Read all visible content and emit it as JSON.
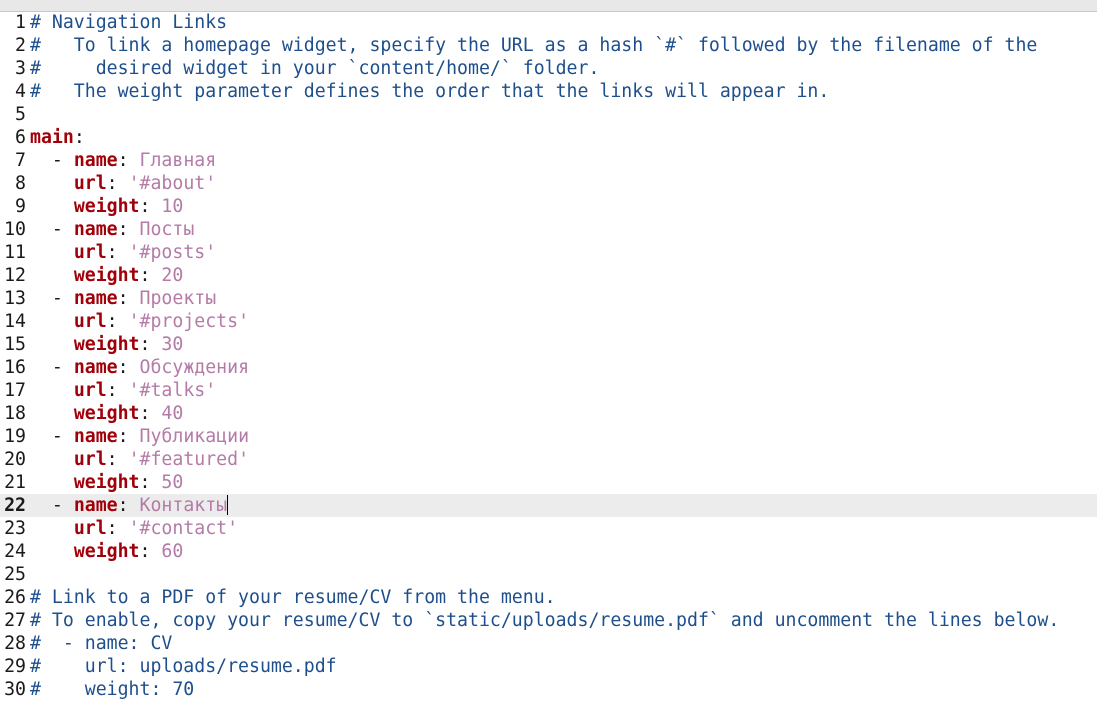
{
  "editor": {
    "current_line": 22,
    "lines": [
      {
        "n": "1",
        "tokens": [
          {
            "t": "# Navigation Links",
            "k": "comment"
          }
        ]
      },
      {
        "n": "2",
        "tokens": [
          {
            "t": "#   To link a homepage widget, specify the URL as a hash `#` followed by the filename of the",
            "k": "comment"
          }
        ]
      },
      {
        "n": "3",
        "tokens": [
          {
            "t": "#     desired widget in your `content/home/` folder.",
            "k": "comment"
          }
        ]
      },
      {
        "n": "4",
        "tokens": [
          {
            "t": "#   The weight parameter defines the order that the links will appear in.",
            "k": "comment"
          }
        ]
      },
      {
        "n": "5",
        "tokens": []
      },
      {
        "n": "6",
        "tokens": [
          {
            "t": "main",
            "k": "key"
          },
          {
            "t": ":",
            "k": "punct"
          }
        ]
      },
      {
        "n": "7",
        "tokens": [
          {
            "t": "  - ",
            "k": "plain"
          },
          {
            "t": "name",
            "k": "key"
          },
          {
            "t": ": ",
            "k": "punct"
          },
          {
            "t": "Главная",
            "k": "str"
          }
        ]
      },
      {
        "n": "8",
        "tokens": [
          {
            "t": "    ",
            "k": "plain"
          },
          {
            "t": "url",
            "k": "key"
          },
          {
            "t": ": ",
            "k": "punct"
          },
          {
            "t": "'#about'",
            "k": "str"
          }
        ]
      },
      {
        "n": "9",
        "tokens": [
          {
            "t": "    ",
            "k": "plain"
          },
          {
            "t": "weight",
            "k": "key"
          },
          {
            "t": ": ",
            "k": "punct"
          },
          {
            "t": "10",
            "k": "num"
          }
        ]
      },
      {
        "n": "10",
        "tokens": [
          {
            "t": "  - ",
            "k": "plain"
          },
          {
            "t": "name",
            "k": "key"
          },
          {
            "t": ": ",
            "k": "punct"
          },
          {
            "t": "Посты",
            "k": "str"
          }
        ]
      },
      {
        "n": "11",
        "tokens": [
          {
            "t": "    ",
            "k": "plain"
          },
          {
            "t": "url",
            "k": "key"
          },
          {
            "t": ": ",
            "k": "punct"
          },
          {
            "t": "'#posts'",
            "k": "str"
          }
        ]
      },
      {
        "n": "12",
        "tokens": [
          {
            "t": "    ",
            "k": "plain"
          },
          {
            "t": "weight",
            "k": "key"
          },
          {
            "t": ": ",
            "k": "punct"
          },
          {
            "t": "20",
            "k": "num"
          }
        ]
      },
      {
        "n": "13",
        "tokens": [
          {
            "t": "  - ",
            "k": "plain"
          },
          {
            "t": "name",
            "k": "key"
          },
          {
            "t": ": ",
            "k": "punct"
          },
          {
            "t": "Проекты",
            "k": "str"
          }
        ]
      },
      {
        "n": "14",
        "tokens": [
          {
            "t": "    ",
            "k": "plain"
          },
          {
            "t": "url",
            "k": "key"
          },
          {
            "t": ": ",
            "k": "punct"
          },
          {
            "t": "'#projects'",
            "k": "str"
          }
        ]
      },
      {
        "n": "15",
        "tokens": [
          {
            "t": "    ",
            "k": "plain"
          },
          {
            "t": "weight",
            "k": "key"
          },
          {
            "t": ": ",
            "k": "punct"
          },
          {
            "t": "30",
            "k": "num"
          }
        ]
      },
      {
        "n": "16",
        "tokens": [
          {
            "t": "  - ",
            "k": "plain"
          },
          {
            "t": "name",
            "k": "key"
          },
          {
            "t": ": ",
            "k": "punct"
          },
          {
            "t": "Обсуждения",
            "k": "str"
          }
        ]
      },
      {
        "n": "17",
        "tokens": [
          {
            "t": "    ",
            "k": "plain"
          },
          {
            "t": "url",
            "k": "key"
          },
          {
            "t": ": ",
            "k": "punct"
          },
          {
            "t": "'#talks'",
            "k": "str"
          }
        ]
      },
      {
        "n": "18",
        "tokens": [
          {
            "t": "    ",
            "k": "plain"
          },
          {
            "t": "weight",
            "k": "key"
          },
          {
            "t": ": ",
            "k": "punct"
          },
          {
            "t": "40",
            "k": "num"
          }
        ]
      },
      {
        "n": "19",
        "tokens": [
          {
            "t": "  - ",
            "k": "plain"
          },
          {
            "t": "name",
            "k": "key"
          },
          {
            "t": ": ",
            "k": "punct"
          },
          {
            "t": "Публикации",
            "k": "str"
          }
        ]
      },
      {
        "n": "20",
        "tokens": [
          {
            "t": "    ",
            "k": "plain"
          },
          {
            "t": "url",
            "k": "key"
          },
          {
            "t": ": ",
            "k": "punct"
          },
          {
            "t": "'#featured'",
            "k": "str"
          }
        ]
      },
      {
        "n": "21",
        "tokens": [
          {
            "t": "    ",
            "k": "plain"
          },
          {
            "t": "weight",
            "k": "key"
          },
          {
            "t": ": ",
            "k": "punct"
          },
          {
            "t": "50",
            "k": "num"
          }
        ]
      },
      {
        "n": "22",
        "tokens": [
          {
            "t": "  - ",
            "k": "plain"
          },
          {
            "t": "name",
            "k": "key"
          },
          {
            "t": ": ",
            "k": "punct"
          },
          {
            "t": "Контакты",
            "k": "str"
          }
        ]
      },
      {
        "n": "23",
        "tokens": [
          {
            "t": "    ",
            "k": "plain"
          },
          {
            "t": "url",
            "k": "key"
          },
          {
            "t": ": ",
            "k": "punct"
          },
          {
            "t": "'#contact'",
            "k": "str"
          }
        ]
      },
      {
        "n": "24",
        "tokens": [
          {
            "t": "    ",
            "k": "plain"
          },
          {
            "t": "weight",
            "k": "key"
          },
          {
            "t": ": ",
            "k": "punct"
          },
          {
            "t": "60",
            "k": "num"
          }
        ]
      },
      {
        "n": "25",
        "tokens": []
      },
      {
        "n": "26",
        "tokens": [
          {
            "t": "# Link to a PDF of your resume/CV from the menu.",
            "k": "comment"
          }
        ]
      },
      {
        "n": "27",
        "tokens": [
          {
            "t": "# To enable, copy your resume/CV to `static/uploads/resume.pdf` and uncomment the lines below.",
            "k": "comment"
          }
        ]
      },
      {
        "n": "28",
        "tokens": [
          {
            "t": "#  - name: CV",
            "k": "comment"
          }
        ]
      },
      {
        "n": "29",
        "tokens": [
          {
            "t": "#    url: uploads/resume.pdf",
            "k": "comment"
          }
        ]
      },
      {
        "n": "30",
        "tokens": [
          {
            "t": "#    weight: 70",
            "k": "comment"
          }
        ]
      }
    ]
  }
}
